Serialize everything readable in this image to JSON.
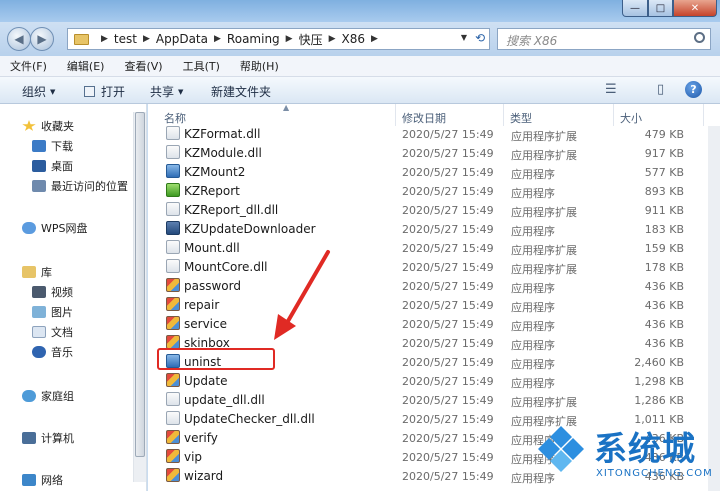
{
  "window": {
    "controls": {
      "minimize": "—",
      "maximize": "□",
      "close": "✕"
    }
  },
  "address": {
    "breadcrumbs": [
      "test",
      "AppData",
      "Roaming",
      "快压",
      "X86"
    ],
    "search_placeholder": "搜索 X86"
  },
  "menu": {
    "items": [
      "文件(F)",
      "编辑(E)",
      "查看(V)",
      "工具(T)",
      "帮助(H)"
    ]
  },
  "commands": {
    "organize": "组织",
    "open": "打开",
    "share": "共享",
    "new_folder": "新建文件夹",
    "view_icon": "☰",
    "preview_icon": "▯",
    "help": "?"
  },
  "nav": {
    "favorites": "收藏夹",
    "downloads": "下载",
    "desktop": "桌面",
    "recent": "最近访问的位置",
    "wps": "WPS网盘",
    "libraries": "库",
    "videos": "视频",
    "pictures": "图片",
    "documents": "文档",
    "music": "音乐",
    "homegroup": "家庭组",
    "computer": "计算机",
    "network": "网络"
  },
  "columns": {
    "name": "名称",
    "modified": "修改日期",
    "type": "类型",
    "size": "大小"
  },
  "files": [
    {
      "name": "KZFormat.dll",
      "date": "2020/5/27 15:49",
      "type": "应用程序扩展",
      "size": "479 KB",
      "icon": "dll"
    },
    {
      "name": "KZModule.dll",
      "date": "2020/5/27 15:49",
      "type": "应用程序扩展",
      "size": "917 KB",
      "icon": "dll"
    },
    {
      "name": "KZMount2",
      "date": "2020/5/27 15:49",
      "type": "应用程序",
      "size": "577 KB",
      "icon": "app-blue"
    },
    {
      "name": "KZReport",
      "date": "2020/5/27 15:49",
      "type": "应用程序",
      "size": "893 KB",
      "icon": "app-green"
    },
    {
      "name": "KZReport_dll.dll",
      "date": "2020/5/27 15:49",
      "type": "应用程序扩展",
      "size": "911 KB",
      "icon": "dll"
    },
    {
      "name": "KZUpdateDownloader",
      "date": "2020/5/27 15:49",
      "type": "应用程序",
      "size": "183 KB",
      "icon": "app-dark"
    },
    {
      "name": "Mount.dll",
      "date": "2020/5/27 15:49",
      "type": "应用程序扩展",
      "size": "159 KB",
      "icon": "dll"
    },
    {
      "name": "MountCore.dll",
      "date": "2020/5/27 15:49",
      "type": "应用程序扩展",
      "size": "178 KB",
      "icon": "dll"
    },
    {
      "name": "password",
      "date": "2020/5/27 15:49",
      "type": "应用程序",
      "size": "436 KB",
      "icon": "app-grad"
    },
    {
      "name": "repair",
      "date": "2020/5/27 15:49",
      "type": "应用程序",
      "size": "436 KB",
      "icon": "app-grad"
    },
    {
      "name": "service",
      "date": "2020/5/27 15:49",
      "type": "应用程序",
      "size": "436 KB",
      "icon": "app-grad"
    },
    {
      "name": "skinbox",
      "date": "2020/5/27 15:49",
      "type": "应用程序",
      "size": "436 KB",
      "icon": "app-grad"
    },
    {
      "name": "uninst",
      "date": "2020/5/27 15:49",
      "type": "应用程序",
      "size": "2,460 KB",
      "icon": "app-blue"
    },
    {
      "name": "Update",
      "date": "2020/5/27 15:49",
      "type": "应用程序",
      "size": "1,298 KB",
      "icon": "app-grad"
    },
    {
      "name": "update_dll.dll",
      "date": "2020/5/27 15:49",
      "type": "应用程序扩展",
      "size": "1,286 KB",
      "icon": "dll"
    },
    {
      "name": "UpdateChecker_dll.dll",
      "date": "2020/5/27 15:49",
      "type": "应用程序扩展",
      "size": "1,011 KB",
      "icon": "dll"
    },
    {
      "name": "verify",
      "date": "2020/5/27 15:49",
      "type": "应用程序",
      "size": "436 KB",
      "icon": "app-grad"
    },
    {
      "name": "vip",
      "date": "2020/5/27 15:49",
      "type": "应用程序",
      "size": "436 KB",
      "icon": "app-grad"
    },
    {
      "name": "wizard",
      "date": "2020/5/27 15:49",
      "type": "应用程序",
      "size": "436 KB",
      "icon": "app-grad"
    }
  ],
  "watermark": {
    "text": "系统城",
    "url": "XITONGCHENG.COM"
  },
  "colors": {
    "highlight": "#e02a24",
    "watermark": "#1a72c4"
  }
}
